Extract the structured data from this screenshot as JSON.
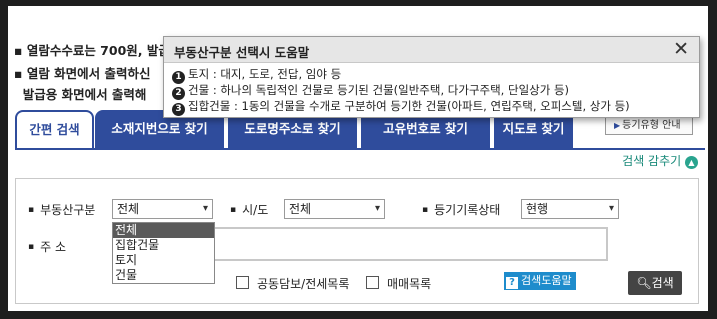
{
  "notices": {
    "line1_prefix": "열람수수료는 700원, 발급",
    "line2": "열람 화면에서 출력하신",
    "line3": "발급용 화면에서 출력해"
  },
  "popup": {
    "title": "부동산구분 선택시 도움말",
    "close_symbol": "✕",
    "items": [
      {
        "num": "1",
        "text": "토지 : 대지, 도로, 전답, 임야 등"
      },
      {
        "num": "2",
        "text": "건물 : 하나의 독립적인 건물로 등기된 건물(일반주택, 다가구주택, 단일상가 등)"
      },
      {
        "num": "3",
        "text": "집합건물 : 1동의 건물을 수개로 구분하여 등기한 건물(아파트, 연립주택, 오피스텔, 상가 등)"
      }
    ]
  },
  "tabs": [
    {
      "label": "간편 검색",
      "active": true
    },
    {
      "label": "소재지번으로 찾기"
    },
    {
      "label": "도로명주소로 찾기"
    },
    {
      "label": "고유번호로 찾기"
    },
    {
      "label": "지도로 찾기"
    }
  ],
  "guide_button": "등기유형 안내",
  "fold_label": "검색 감추기",
  "search": {
    "property_type_label": "부동산구분",
    "property_type_value": "전체",
    "property_type_options": [
      "전체",
      "집합건물",
      "토지",
      "건물"
    ],
    "sido_label": "시/도",
    "sido_value": "전체",
    "record_status_label": "등기기록상태",
    "record_status_value": "현행",
    "address_label": "주 소",
    "checkbox_collateral": "공동담보/전세목록",
    "checkbox_sales": "매매목록",
    "help_button": "검색도움말",
    "search_button": "검색"
  },
  "colors": {
    "tab_blue": "#2f4c9c",
    "help_blue": "#1e8ccc",
    "fold_teal": "#2aa48f"
  }
}
